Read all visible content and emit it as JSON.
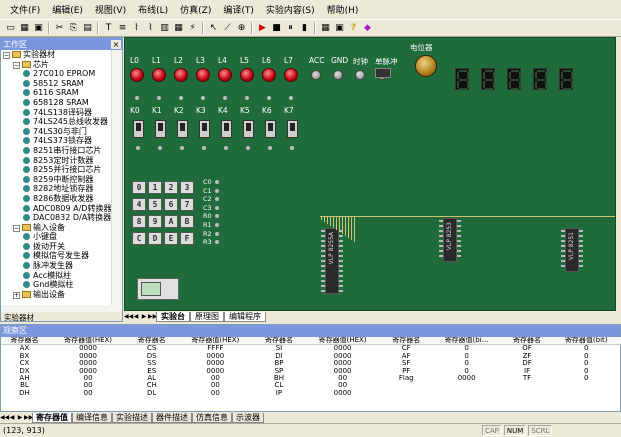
{
  "menu": [
    "文件(F)",
    "编辑(E)",
    "视图(V)",
    "布线(L)",
    "仿真(Z)",
    "编译(T)",
    "实验内容(S)",
    "帮助(H)"
  ],
  "toolbar": {
    "icons": [
      "new-icon",
      "open-icon",
      "save-icon",
      "cut-icon",
      "copy-icon",
      "paste-icon",
      "text-icon",
      "align-icon",
      "wire-icon",
      "bus-icon",
      "grid-icon",
      "layer-icon",
      "pin-icon",
      "pointer-icon",
      "wire2-icon",
      "zoom-icon",
      "run-icon",
      "stop-icon",
      "pause-icon",
      "step-icon",
      "meter-icon",
      "monitor-icon",
      "help-icon",
      "book-icon"
    ],
    "glyphs": [
      "▭",
      "▦",
      "▣",
      "✂",
      "⎘",
      "▤",
      "T",
      "≡",
      "⌇",
      "⌇",
      "▥",
      "▦",
      "⚡",
      "↖",
      "⟋",
      "⊕",
      "▶",
      "■",
      "⏸",
      "▮",
      "▦",
      "▣",
      "?",
      "◆"
    ]
  },
  "left_panel": {
    "title": "工作区",
    "close": "×",
    "bottom_tab": "实验器材",
    "tree": [
      {
        "level": 0,
        "kind": "pm",
        "label": "实验器材",
        "expand": "−"
      },
      {
        "level": 1,
        "kind": "pm",
        "label": "芯片",
        "expand": "−"
      },
      {
        "level": 2,
        "kind": "leaf",
        "label": "27C010 EPROM"
      },
      {
        "level": 2,
        "kind": "leaf",
        "label": "58512 SRAM"
      },
      {
        "level": 2,
        "kind": "leaf",
        "label": "6116 SRAM"
      },
      {
        "level": 2,
        "kind": "leaf",
        "label": "658128 SRAM"
      },
      {
        "level": 2,
        "kind": "leaf",
        "label": "74LS138译码器"
      },
      {
        "level": 2,
        "kind": "leaf",
        "label": "74LS245总线收发器"
      },
      {
        "level": 2,
        "kind": "leaf",
        "label": "74LS30与非门"
      },
      {
        "level": 2,
        "kind": "leaf",
        "label": "74LS373锁存器"
      },
      {
        "level": 2,
        "kind": "leaf",
        "label": "8251串行接口芯片"
      },
      {
        "level": 2,
        "kind": "leaf",
        "label": "8253定时计数器"
      },
      {
        "level": 2,
        "kind": "leaf",
        "label": "8255并行接口芯片"
      },
      {
        "level": 2,
        "kind": "leaf",
        "label": "8259中断控制器"
      },
      {
        "level": 2,
        "kind": "leaf",
        "label": "8282地址锁存器"
      },
      {
        "level": 2,
        "kind": "leaf",
        "label": "8286数据收发器"
      },
      {
        "level": 2,
        "kind": "leaf",
        "label": "ADC0809 A/D转换器"
      },
      {
        "level": 2,
        "kind": "leaf",
        "label": "DAC0832 D/A转换器"
      },
      {
        "level": 1,
        "kind": "pm",
        "label": "输入设备",
        "expand": "−"
      },
      {
        "level": 2,
        "kind": "leaf",
        "label": "小键盘"
      },
      {
        "level": 2,
        "kind": "leaf",
        "label": "拨动开关"
      },
      {
        "level": 2,
        "kind": "leaf",
        "label": "模拟信号发生器"
      },
      {
        "level": 2,
        "kind": "leaf",
        "label": "脉冲发生器"
      },
      {
        "level": 2,
        "kind": "leaf",
        "label": "Acc模拟柱"
      },
      {
        "level": 2,
        "kind": "leaf",
        "label": "Gnd模拟柱"
      },
      {
        "level": 1,
        "kind": "pm",
        "label": "输出设备",
        "expand": "+"
      }
    ]
  },
  "board": {
    "led_labels": [
      "L0",
      "L1",
      "L2",
      "L3",
      "L4",
      "L5",
      "L6",
      "L7"
    ],
    "misc_labels": [
      "ACC",
      "GND",
      "时钟",
      "单脉冲"
    ],
    "pot_label": "电位器",
    "switch_labels": [
      "K0",
      "K1",
      "K2",
      "K3",
      "K4",
      "K5",
      "K6",
      "K7"
    ],
    "keys": [
      "0",
      "1",
      "2",
      "3",
      "4",
      "5",
      "6",
      "7",
      "8",
      "9",
      "A",
      "B",
      "C",
      "D",
      "E",
      "F"
    ],
    "key_rows": [
      "C0",
      "C1",
      "C2",
      "C3",
      "R0",
      "R1",
      "R2",
      "R3"
    ],
    "chips": [
      "VLP 8255A",
      "VLP 8253",
      "VLP 8251"
    ],
    "tabs": [
      "实验台",
      "原理图",
      "编辑程序"
    ],
    "active_tab": 0
  },
  "observe": {
    "title": "观察区",
    "headers": [
      "寄存器名",
      "寄存器值(HEX)",
      "寄存器名",
      "寄存器值(HEX)",
      "寄存器名",
      "寄存器值(HEX)",
      "寄存器名",
      "寄存器值(bi…",
      "寄存器名",
      "寄存器值(bit)"
    ],
    "rows": [
      [
        "AX",
        "0000",
        "CS",
        "FFFF",
        "SI",
        "0000",
        "CF",
        "0",
        "OF",
        "0"
      ],
      [
        "BX",
        "0000",
        "DS",
        "0000",
        "DI",
        "0000",
        "AF",
        "0",
        "ZF",
        "0"
      ],
      [
        "CX",
        "0000",
        "SS",
        "0000",
        "BP",
        "0000",
        "SF",
        "0",
        "DF",
        "0"
      ],
      [
        "DX",
        "0000",
        "ES",
        "0000",
        "SP",
        "0000",
        "PF",
        "0",
        "IF",
        "0"
      ],
      [
        "AH",
        "00",
        "AL",
        "00",
        "BH",
        "00",
        "Flag",
        "0000",
        "TF",
        "0"
      ],
      [
        "BL",
        "00",
        "CH",
        "00",
        "CL",
        "00",
        "",
        "",
        "",
        ""
      ],
      [
        "DH",
        "00",
        "DL",
        "00",
        "IP",
        "0000",
        "",
        "",
        "",
        ""
      ]
    ],
    "tabs": [
      "寄存器值",
      "编译信息",
      "实验描述",
      "器件描述",
      "仿真信息",
      "示波器"
    ],
    "active_tab": 0
  },
  "status": {
    "coords": "(123, 913)",
    "caps": "CAP",
    "num": "NUM",
    "scrl": "SCRL"
  }
}
